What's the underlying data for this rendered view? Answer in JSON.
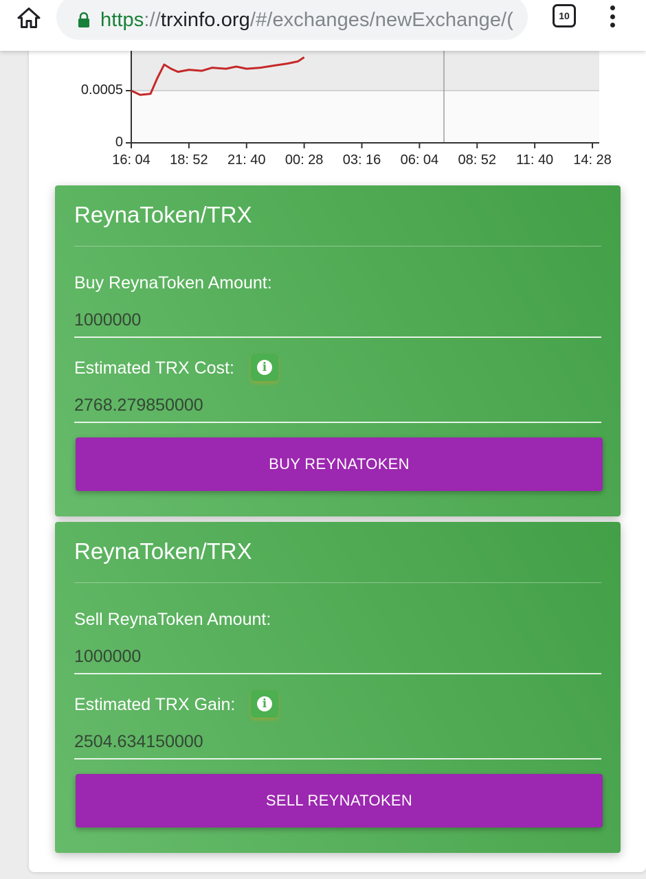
{
  "browser": {
    "url_scheme": "https",
    "url_sep": "://",
    "url_host": "trxinfo.org",
    "url_path": "/#/exchanges/newExchange/(",
    "tab_count": "10"
  },
  "chart_data": {
    "type": "line",
    "y_ticks": [
      "0.0005",
      "0"
    ],
    "x_ticks": [
      "16: 04",
      "18: 52",
      "21: 40",
      "00: 28",
      "03: 16",
      "06: 04",
      "08: 52",
      "11: 40",
      "14: 28"
    ],
    "series": [
      {
        "color": "#c62828",
        "x": [
          "16: 04",
          "16: 30",
          "17: 00",
          "17: 20",
          "17: 40",
          "18: 00",
          "18: 20",
          "18: 52",
          "19: 30",
          "20: 00",
          "20: 40",
          "21: 10",
          "21: 40",
          "22: 20",
          "23: 00",
          "23: 40",
          "00: 10",
          "00: 28"
        ],
        "values": [
          0.0005,
          0.00046,
          0.00047,
          0.00062,
          0.00075,
          0.00071,
          0.00068,
          0.0007,
          0.00069,
          0.00072,
          0.00071,
          0.00073,
          0.00071,
          0.00072,
          0.00074,
          0.00076,
          0.00078,
          0.00082
        ]
      }
    ],
    "ylim": [
      0,
      0.0011
    ],
    "grid": true,
    "highlight_band": "upper"
  },
  "buy_panel": {
    "title": "ReynaToken/TRX",
    "amount_label": "Buy ReynaToken Amount:",
    "amount_value": "1000000",
    "estimate_label": "Estimated TRX Cost:",
    "estimate_value": "2768.279850000",
    "button_label": "BUY REYNATOKEN"
  },
  "sell_panel": {
    "title": "ReynaToken/TRX",
    "amount_label": "Sell ReynaToken Amount:",
    "amount_value": "1000000",
    "estimate_label": "Estimated TRX Gain:",
    "estimate_value": "2504.634150000",
    "button_label": "SELL REYNATOKEN"
  },
  "colors": {
    "panel_green": "#4caf50",
    "button_purple": "#9c27b0",
    "line_red": "#c62828"
  },
  "icons": [
    "home-icon",
    "lock-icon",
    "tab-switcher-icon",
    "more-vert-icon",
    "info-icon"
  ]
}
